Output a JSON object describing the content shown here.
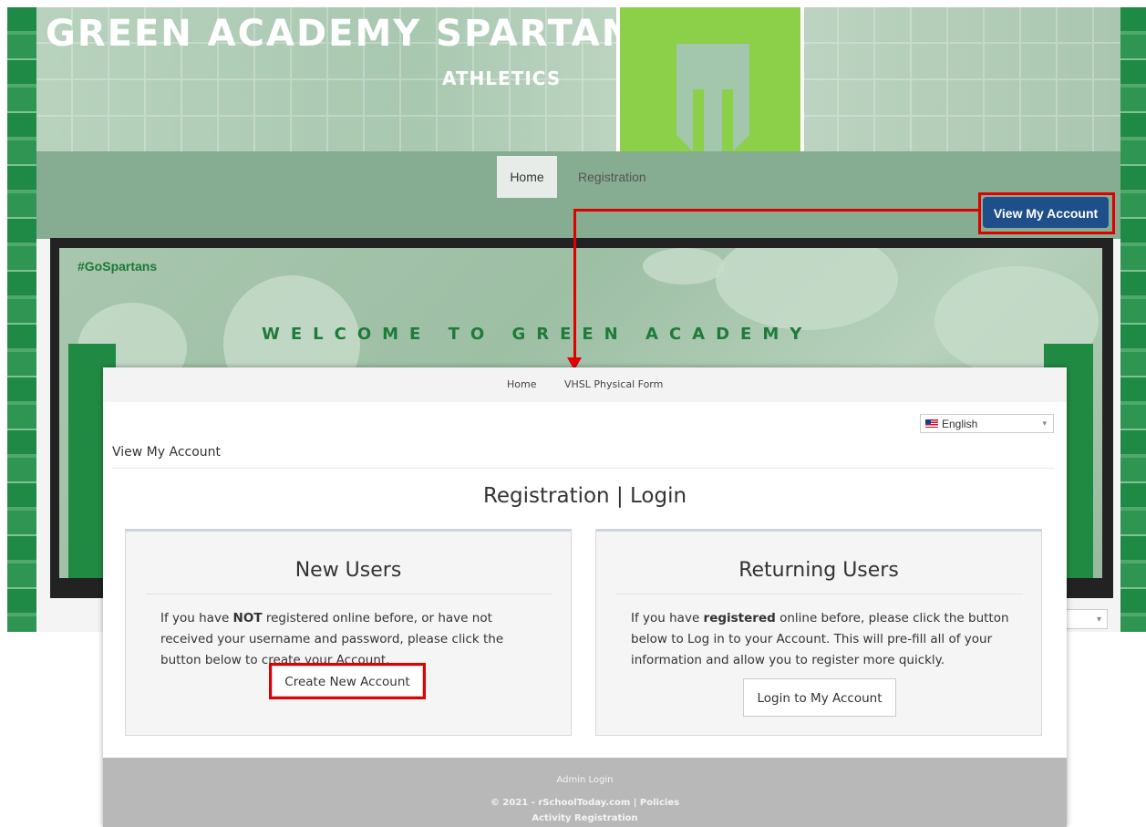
{
  "site": {
    "banner_title": "GREEN ACADEMY SPARTANS",
    "banner_subtitle": "ATHLETICS",
    "nav": {
      "home": "Home",
      "registration": "Registration"
    },
    "view_account_button": "View My Account",
    "hero": {
      "hashtag": "#GoSpartans",
      "welcome": "WELCOME TO GREEN ACADEMY"
    }
  },
  "portal": {
    "nav": {
      "home": "Home",
      "vhsl": "VHSL Physical Form"
    },
    "language": {
      "selected": "English"
    },
    "page_heading": "View My Account",
    "title": "Registration | Login",
    "new_users": {
      "title": "New Users",
      "text_before": "If you have ",
      "text_bold": "NOT",
      "text_after": " registered online before, or have not received your username and password, please click the button below to create your Account.",
      "button": "Create New Account"
    },
    "returning_users": {
      "title": "Returning Users",
      "text_before": "If you have ",
      "text_bold": "registered",
      "text_after": " online before, please click the button below to Log in to your Account. This will pre-fill all of your information and allow you to register more quickly.",
      "button": "Login to My Account"
    },
    "footer": {
      "admin_login": "Admin Login",
      "copyright": "© 2021 - rSchoolToday.com | Policies",
      "activity": "Activity Registration"
    }
  },
  "colors": {
    "highlight": "#e00000",
    "account_button": "#1f4f8a",
    "school_green": "#218a42"
  }
}
